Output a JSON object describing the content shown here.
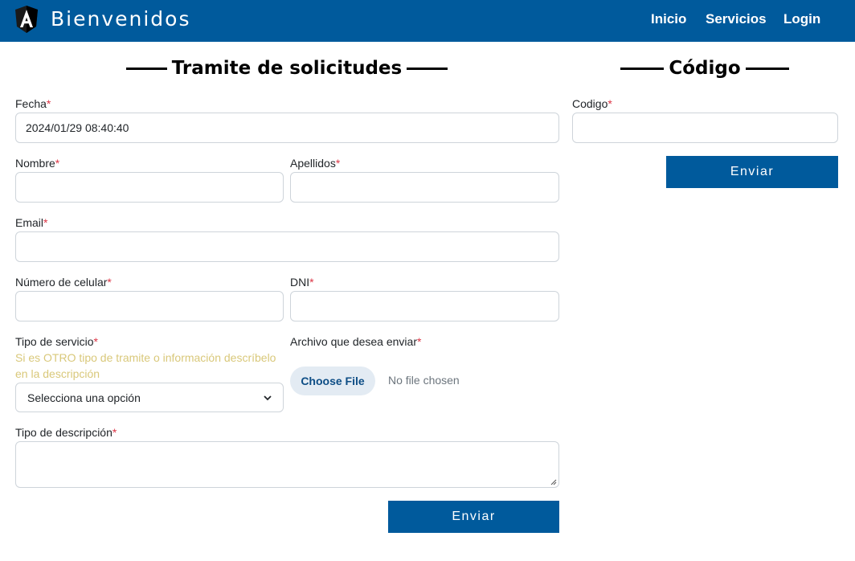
{
  "navbar": {
    "brand": "Bienvenidos",
    "logo_icon": "angular-logo-icon",
    "links": [
      "Inicio",
      "Servicios",
      "Login"
    ]
  },
  "form": {
    "title": "Tramite de solicitudes",
    "required_mark": "*",
    "fecha": {
      "label": "Fecha",
      "value": "2024/01/29 08:40:40"
    },
    "nombre": {
      "label": "Nombre",
      "value": ""
    },
    "apellidos": {
      "label": "Apellidos",
      "value": ""
    },
    "email": {
      "label": "Email",
      "value": ""
    },
    "celular": {
      "label": "Número de celular",
      "value": ""
    },
    "dni": {
      "label": "DNI",
      "value": ""
    },
    "tipo_servicio": {
      "label": "Tipo de servicio",
      "hint": "Si es OTRO tipo de tramite o información descríbelo en la descripción",
      "selected": "Selecciona una opción"
    },
    "archivo": {
      "label": "Archivo que desea enviar",
      "button": "Choose File",
      "status": "No file chosen"
    },
    "descripcion": {
      "label": "Tipo de descripción",
      "value": ""
    },
    "submit": "Enviar"
  },
  "codigo_panel": {
    "title": "Código",
    "codigo": {
      "label": "Codigo",
      "value": ""
    },
    "submit": "Enviar"
  },
  "colors": {
    "primary": "#005a9c",
    "required": "#dc3545",
    "hint": "#d9c87a"
  }
}
